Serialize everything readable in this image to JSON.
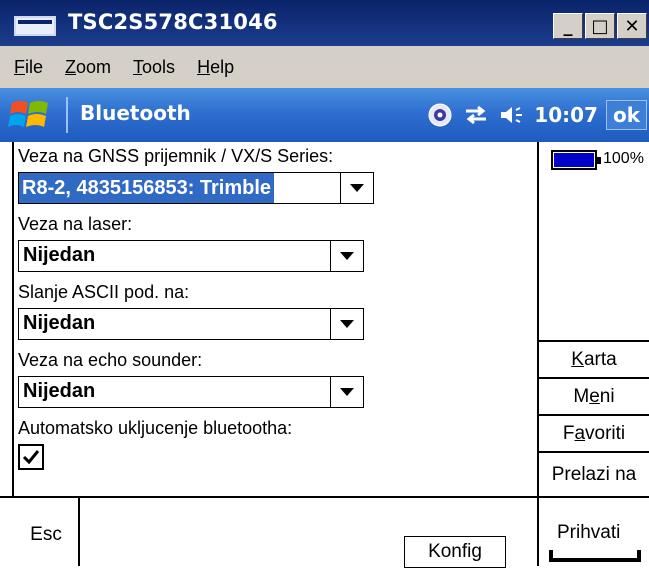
{
  "window": {
    "title": "TSC2S578C31046",
    "minimize_glyph": "_",
    "maximize_glyph": "□",
    "close_glyph": "✕"
  },
  "menu": {
    "items": [
      {
        "label": "File"
      },
      {
        "label": "Zoom"
      },
      {
        "label": "Tools"
      },
      {
        "label": "Help"
      }
    ]
  },
  "header": {
    "title": "Bluetooth",
    "time": "10:07",
    "ok_label": "ok",
    "icons": [
      "windows-start-icon",
      "bluetooth-icon",
      "connectivity-icon",
      "volume-icon"
    ]
  },
  "form": {
    "gnss_label": "Veza na GNSS prijemnik / VX/S Series:",
    "gnss_value": "R8-2, 4835156853: Trimble",
    "laser_label": "Veza na laser:",
    "laser_value": "Nijedan",
    "ascii_label": "Slanje ASCII pod. na:",
    "ascii_value": "Nijedan",
    "echo_label": "Veza na echo sounder:",
    "echo_value": "Nijedan",
    "auto_label": "Automatsko ukljucenje bluetootha:",
    "auto_checked": true,
    "check_glyph": "✓"
  },
  "status": {
    "battery_level": 1.0,
    "battery_text": "100%"
  },
  "side_buttons": [
    {
      "label": "Karta"
    },
    {
      "label": "Meni"
    },
    {
      "label": "Favoriti"
    },
    {
      "label": "Prelazi na"
    }
  ],
  "bottom": {
    "esc_label": "Esc",
    "konfig_label": "Konfig",
    "prihvati_label": "Prihvati"
  },
  "colors": {
    "title_bar": "#0a246a",
    "header_blue": "#2e6fcf",
    "selection": "#316ac5",
    "battery_fill": "#0000c8"
  }
}
